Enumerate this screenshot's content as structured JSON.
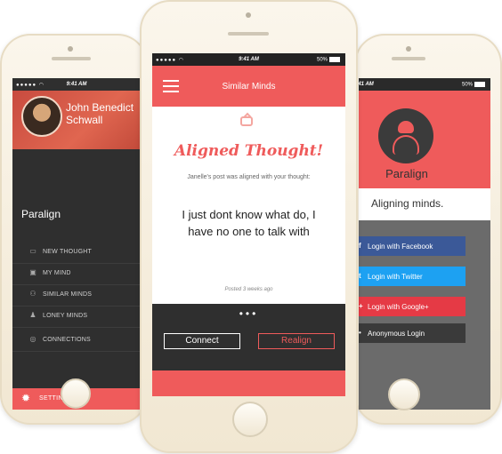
{
  "status": {
    "time": "9:41 AM",
    "battery": "50%",
    "signal": "●●●●● ◠"
  },
  "left": {
    "user_name": "John Benedict Schwall",
    "app_name": "Paralign",
    "menu": [
      {
        "label": "NEW THOUGHT",
        "icon": "chat-bubble-icon"
      },
      {
        "label": "MY MIND",
        "icon": "image-icon"
      },
      {
        "label": "SIMILAR MINDS",
        "icon": "people-icon"
      },
      {
        "label": "LONEY MINDS",
        "icon": "person-icon"
      },
      {
        "label": "CONNECTIONS",
        "icon": "globe-icon"
      }
    ],
    "settings_label": "SETTINGS"
  },
  "center": {
    "nav_title": "Similar Minds",
    "headline": "Aligned Thought!",
    "subline": "Janelle's post was aligned with your thought:",
    "quote": "I just dont know what do, I have no one to talk with",
    "posted": "Posted 3 weeks ago",
    "pager": "•••",
    "connect_label": "Connect",
    "realign_label": "Realign"
  },
  "right": {
    "brand": "Paralign",
    "tagline": "Aligning minds.",
    "buttons": [
      {
        "label": "Login with Facebook",
        "icon": "f",
        "color": "#3b5998"
      },
      {
        "label": "Login with Twitter",
        "icon": "t",
        "color": "#1da1f2"
      },
      {
        "label": "Login with Google+",
        "icon": "+",
        "color": "#e53a45"
      },
      {
        "label": "Anonymous Login",
        "icon": "•",
        "color": "#3a3a3a"
      }
    ]
  },
  "colors": {
    "accent": "#ef5b5b",
    "dark": "#2f2f2f"
  }
}
